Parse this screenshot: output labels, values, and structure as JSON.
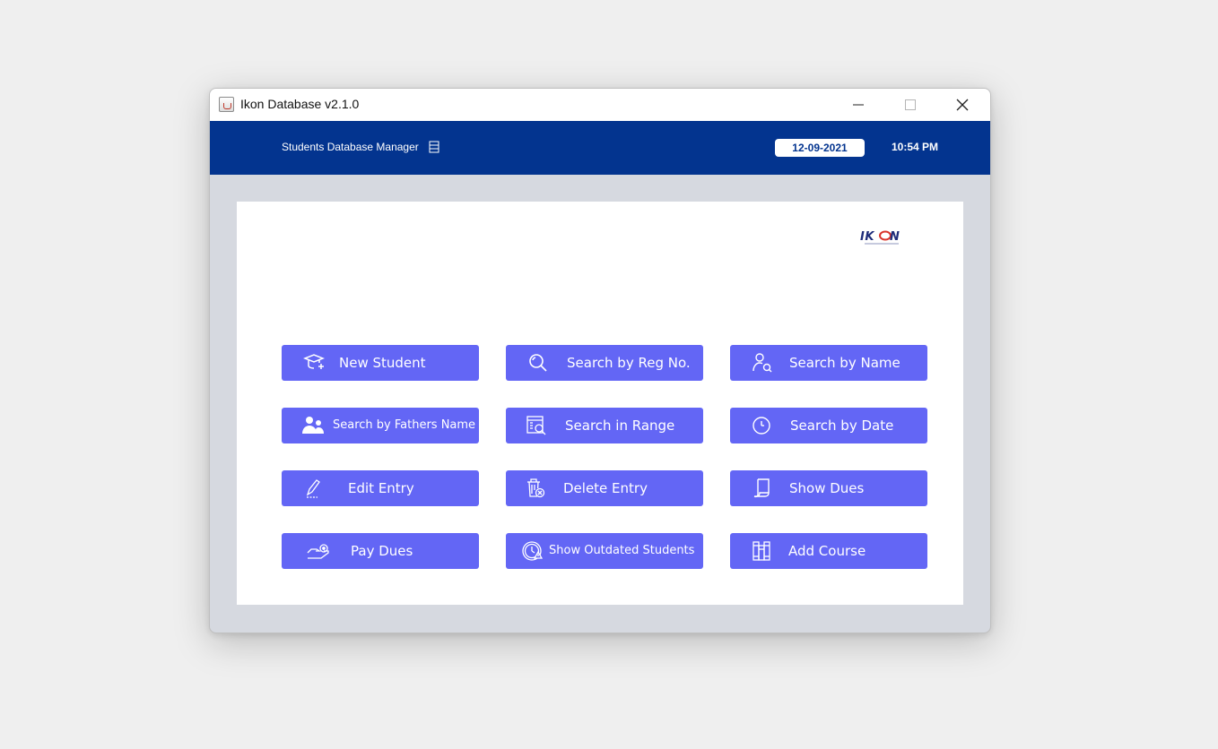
{
  "window": {
    "title": "Ikon Database v2.1.0"
  },
  "header": {
    "title": "Students Database Manager",
    "date": "12-09-2021",
    "time": "10:54 PM"
  },
  "colors": {
    "header_bg": "#03348f",
    "button_bg": "#6366f5",
    "window_bg": "#d6d9e0"
  },
  "buttons": [
    {
      "label": "New Student",
      "icon": "graduation-cap-plus-icon"
    },
    {
      "label": "Search by Reg No.",
      "icon": "magnifier-icon"
    },
    {
      "label": "Search by Name",
      "icon": "user-search-icon"
    },
    {
      "label": "Search by Fathers Name",
      "icon": "users-icon"
    },
    {
      "label": "Search in Range",
      "icon": "list-search-icon"
    },
    {
      "label": "Search by Date",
      "icon": "clock-icon"
    },
    {
      "label": "Edit Entry",
      "icon": "pencil-icon"
    },
    {
      "label": "Delete Entry",
      "icon": "trash-icon"
    },
    {
      "label": "Show Dues",
      "icon": "scroll-icon"
    },
    {
      "label": "Pay Dues",
      "icon": "hand-coin-icon"
    },
    {
      "label": "Show Outdated Students",
      "icon": "expired-clock-icon"
    },
    {
      "label": "Add Course",
      "icon": "books-icon"
    }
  ]
}
